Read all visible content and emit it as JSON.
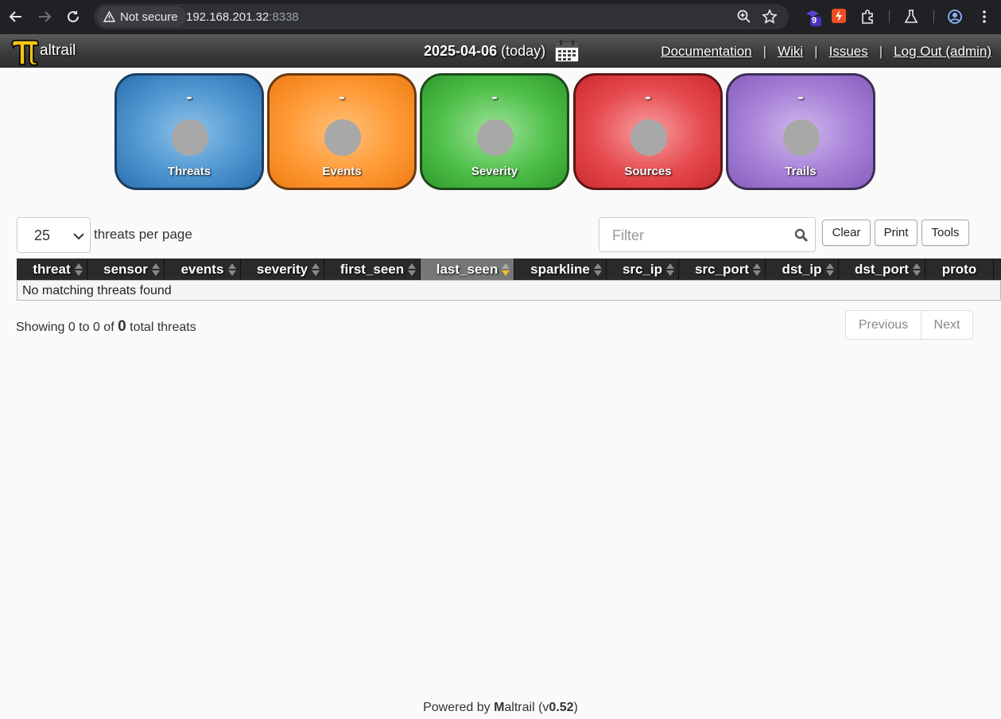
{
  "browser": {
    "security_label": "Not secure",
    "url_host": "192.168.201.32",
    "url_port": ":8338",
    "extension_badge": "9"
  },
  "app": {
    "logo_text": "altrail",
    "date": "2025-04-06",
    "date_suffix": "(today)",
    "nav": {
      "documentation": "Documentation",
      "wiki": "Wiki",
      "issues": "Issues",
      "logout": "Log Out (admin)",
      "separator": "|"
    }
  },
  "counters": [
    {
      "value": "-",
      "label": "Threats",
      "color": "#4e96d0"
    },
    {
      "value": "-",
      "label": "Events",
      "color": "#ff9a35"
    },
    {
      "value": "-",
      "label": "Severity",
      "color": "#4fc04a"
    },
    {
      "value": "-",
      "label": "Sources",
      "color": "#e64a4e"
    },
    {
      "value": "-",
      "label": "Trails",
      "color": "#a67fd6"
    }
  ],
  "controls": {
    "per_page_value": "25",
    "per_page_label": "threats per page",
    "filter_placeholder": "Filter",
    "clear": "Clear",
    "print": "Print",
    "tools": "Tools"
  },
  "table": {
    "columns": [
      "threat",
      "sensor",
      "events",
      "severity",
      "first_seen",
      "last_seen",
      "sparkline",
      "src_ip",
      "src_port",
      "dst_ip",
      "dst_port",
      "proto"
    ],
    "sorted_column": "last_seen",
    "empty_message": "No matching threats found"
  },
  "summary": {
    "prefix": "Showing 0 to 0 of",
    "total": "0",
    "suffix": "total threats"
  },
  "pagination": {
    "previous": "Previous",
    "next": "Next"
  },
  "footer": {
    "powered_by": "Powered by",
    "brand_initial": "M",
    "brand_rest": "altrail (v",
    "version": "0.52",
    "close": ")"
  }
}
